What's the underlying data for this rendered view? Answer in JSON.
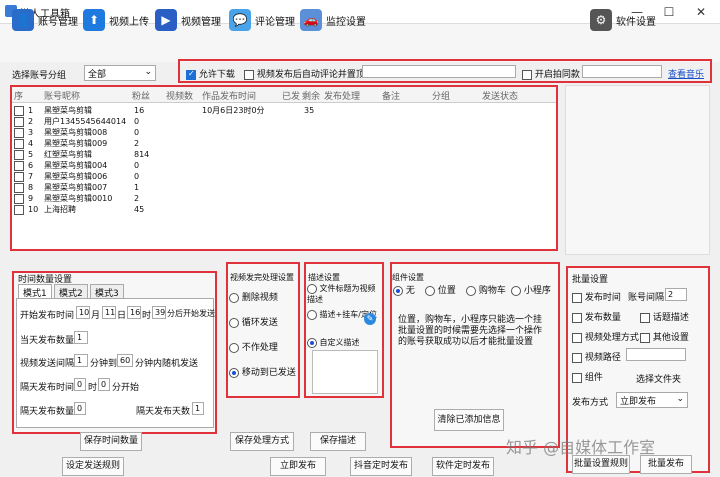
{
  "app": {
    "title": "懒人工具箱",
    "min": "—",
    "max": "☐",
    "close": "✕"
  },
  "toolbar": {
    "account": "账号管理",
    "upload": "视频上传",
    "videos": "视频管理",
    "comments": "评论管理",
    "monitor": "监控设置",
    "settings": "软件设置"
  },
  "filter": {
    "group_label": "选择账号分组",
    "group_value": "全部",
    "allow_download": "允许下载",
    "pin_comment": "视频发布后自动评论并置顶",
    "enable_same": "开启拍同款",
    "view_music": "查看音乐"
  },
  "table": {
    "headers": [
      "序",
      "账号昵称",
      "粉丝",
      "视频数",
      "作品发布时间",
      "已发",
      "剩余",
      "发布处理",
      "备注",
      "分组",
      "发送状态"
    ],
    "rows": [
      {
        "n": "1",
        "name": "黑塑菜鸟剪辑",
        "fans": "16",
        "time": "10月6日23时0分",
        "left": "35"
      },
      {
        "n": "2",
        "name": "用户1345545644014",
        "fans": "0",
        "time": "",
        "left": ""
      },
      {
        "n": "3",
        "name": "黑塑菜鸟剪辑008",
        "fans": "0",
        "time": "",
        "left": ""
      },
      {
        "n": "4",
        "name": "黑塑菜鸟剪辑009",
        "fans": "2",
        "time": "",
        "left": ""
      },
      {
        "n": "5",
        "name": "红塑菜鸟剪辑",
        "fans": "814",
        "time": "",
        "left": ""
      },
      {
        "n": "6",
        "name": "黑塑菜鸟剪辑004",
        "fans": "0",
        "time": "",
        "left": ""
      },
      {
        "n": "7",
        "name": "黑塑菜鸟剪辑006",
        "fans": "0",
        "time": "",
        "left": ""
      },
      {
        "n": "8",
        "name": "黑塑菜鸟剪辑007",
        "fans": "1",
        "time": "",
        "left": ""
      },
      {
        "n": "9",
        "name": "黑塑菜鸟剪辑0010",
        "fans": "2",
        "time": "",
        "left": ""
      },
      {
        "n": "10",
        "name": "上海招聘",
        "fans": "45",
        "time": "",
        "left": ""
      }
    ]
  },
  "timing": {
    "title": "时间数量设置",
    "tabs": [
      "模式1",
      "模式2",
      "模式3"
    ],
    "start_label": "开始发布时间",
    "month": "10",
    "m": "月",
    "day": "11",
    "d": "日",
    "hour": "16",
    "h": "时",
    "min": "39",
    "after": "分后开始发送",
    "daily_label": "当天发布数量",
    "daily": "1",
    "interval_label": "视频发送间隔",
    "iv1": "1",
    "iv_mid": "分钟到",
    "iv2": "60",
    "iv_end": "分钟内随机发送",
    "next_label": "隔天发布时间",
    "nh": "0",
    "nh_unit": "时",
    "nm": "0",
    "nm_unit": "分开始",
    "next_count_label": "隔天发布数量",
    "next_count": "0",
    "next_days_label": "隔天发布天数",
    "next_days": "1",
    "save": "保存时间数量"
  },
  "process": {
    "title": "视频发完处理设置",
    "opts": [
      "删除视频",
      "循环发送",
      "不作处理",
      "移动到已发送"
    ],
    "save": "保存处理方式"
  },
  "desc": {
    "title": "描述设置",
    "opt1": "文件标题为视频描述",
    "opt2": "描述+挂车/定位",
    "opt3": "自定义描述",
    "save": "保存描述"
  },
  "component": {
    "title": "组件设置",
    "opts": [
      "无",
      "位置",
      "购物车",
      "小程序"
    ],
    "note1": "位置，购物车，小程序只能选一个挂",
    "note2": "批量设置的时候需要先选择一个操作的账号获取成功以后才能批量设置",
    "clear": "清除已添加信息"
  },
  "batch": {
    "title": "批量设置",
    "pub_time": "发布时间",
    "acc_interval": "账号间隔",
    "acc_interval_val": "2",
    "pub_count": "发布数量",
    "topic": "话题描述",
    "process": "视频处理方式",
    "other": "其他设置",
    "path": "视频路径",
    "component": "组件",
    "choose_folder": "选择文件夹",
    "mode_label": "发布方式",
    "mode_value": "立即发布",
    "rule": "批量设置规则",
    "publish": "批量发布"
  },
  "bottom": {
    "set_rule": "设定发送规则",
    "now": "立即发布",
    "douyin_timer": "抖音定时发布",
    "soft_timer": "软件定时发布"
  },
  "watermark": "知乎 @自媒体工作室"
}
